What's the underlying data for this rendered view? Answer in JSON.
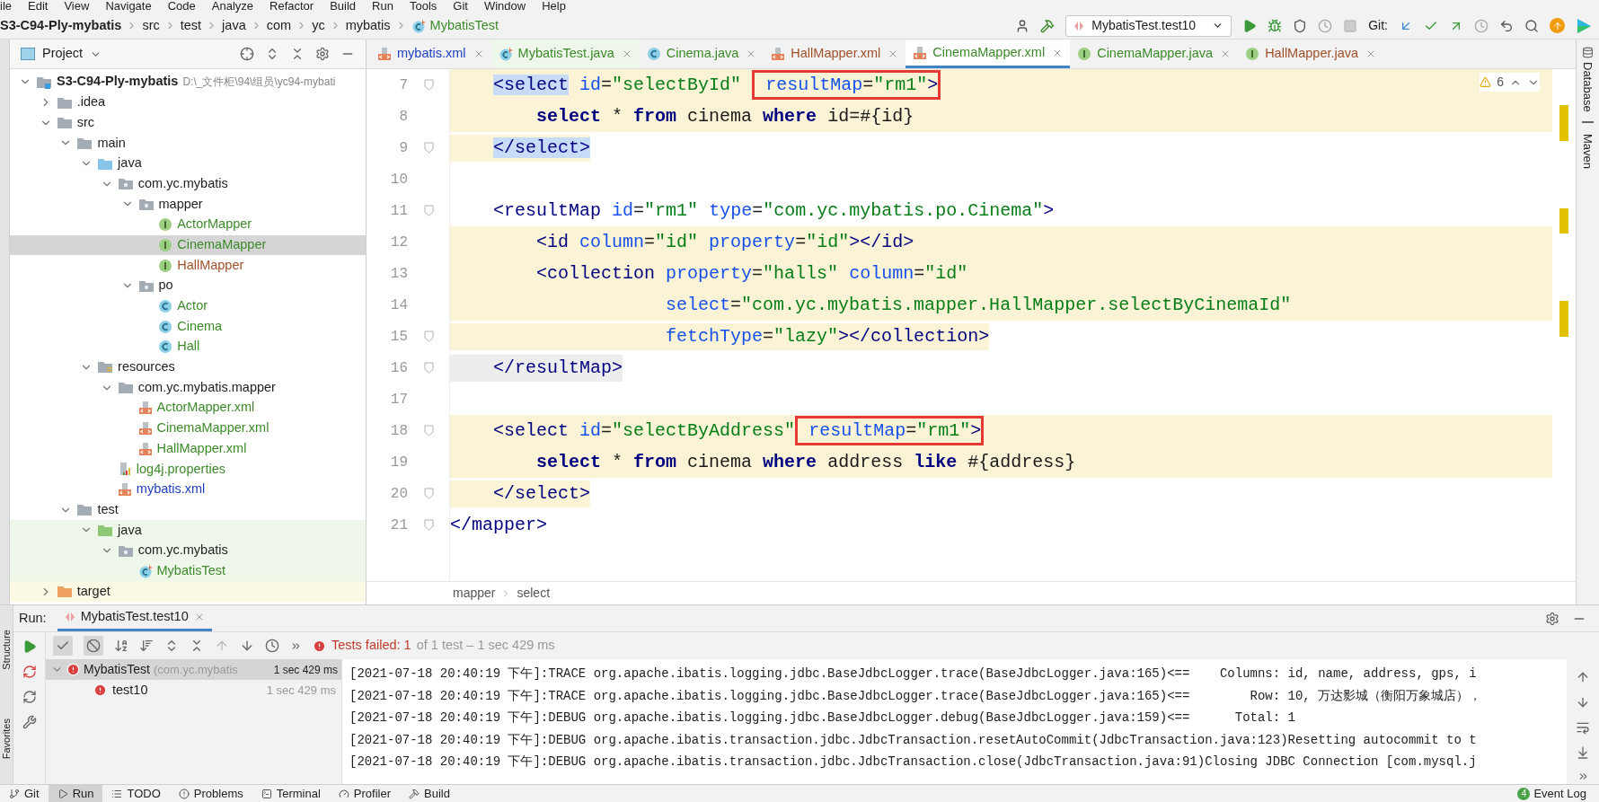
{
  "menu": [
    "ile",
    "Edit",
    "View",
    "Navigate",
    "Code",
    "Analyze",
    "Refactor",
    "Build",
    "Run",
    "Tools",
    "Git",
    "Window",
    "Help"
  ],
  "breadcrumb": [
    {
      "label": "S3-C94-Ply-mybatis",
      "kind": "project"
    },
    {
      "label": "src",
      "kind": "folder"
    },
    {
      "label": "test",
      "kind": "folder"
    },
    {
      "label": "java",
      "kind": "folder"
    },
    {
      "label": "com",
      "kind": "folder"
    },
    {
      "label": "yc",
      "kind": "folder"
    },
    {
      "label": "mybatis",
      "kind": "folder"
    },
    {
      "label": "MybatisTest",
      "kind": "test-class"
    }
  ],
  "toolbar": {
    "run_config": "MybatisTest.test10",
    "git_label": "Git:"
  },
  "project": {
    "title": "Project",
    "tree": [
      {
        "label": "S3-C94-Ply-mybatis",
        "path": "D:\\_文件柜\\94\\组员\\yc94-mybati",
        "kind": "module",
        "expanded": true,
        "selected": false,
        "children": [
          {
            "label": ".idea",
            "kind": "folder",
            "expanded": false,
            "selected": false
          },
          {
            "label": "src",
            "kind": "folder",
            "expanded": true,
            "selected": false,
            "children": [
              {
                "label": "main",
                "kind": "folder",
                "expanded": true,
                "selected": false,
                "children": [
                  {
                    "label": "java",
                    "kind": "source",
                    "expanded": true,
                    "selected": false,
                    "children": [
                      {
                        "label": "com.yc.mybatis",
                        "kind": "package",
                        "expanded": true,
                        "selected": false,
                        "children": [
                          {
                            "label": "mapper",
                            "kind": "package",
                            "expanded": true,
                            "selected": false,
                            "children": [
                              {
                                "label": "ActorMapper",
                                "kind": "interface",
                                "color": "#3d8a2a",
                                "selected": false
                              },
                              {
                                "label": "CinemaMapper",
                                "kind": "interface",
                                "color": "#3d8a2a",
                                "selected": true
                              },
                              {
                                "label": "HallMapper",
                                "kind": "interface",
                                "color": "#a0502a",
                                "selected": false
                              }
                            ]
                          },
                          {
                            "label": "po",
                            "kind": "package",
                            "expanded": true,
                            "selected": false,
                            "children": [
                              {
                                "label": "Actor",
                                "kind": "class",
                                "color": "#3d8a2a",
                                "selected": false
                              },
                              {
                                "label": "Cinema",
                                "kind": "class",
                                "color": "#3d8a2a",
                                "selected": false
                              },
                              {
                                "label": "Hall",
                                "kind": "class",
                                "color": "#3d8a2a",
                                "selected": false
                              }
                            ]
                          }
                        ]
                      }
                    ]
                  },
                  {
                    "label": "resources",
                    "kind": "resource",
                    "expanded": true,
                    "selected": false,
                    "children": [
                      {
                        "label": "com.yc.mybatis.mapper",
                        "kind": "folder",
                        "expanded": true,
                        "selected": false,
                        "children": [
                          {
                            "label": "ActorMapper.xml",
                            "kind": "xml",
                            "color": "#3d8a2a",
                            "selected": false
                          },
                          {
                            "label": "CinemaMapper.xml",
                            "kind": "xml",
                            "color": "#3d8a2a",
                            "selected": false
                          },
                          {
                            "label": "HallMapper.xml",
                            "kind": "xml",
                            "color": "#3d8a2a",
                            "selected": false
                          }
                        ]
                      },
                      {
                        "label": "log4j.properties",
                        "kind": "properties",
                        "color": "#3d8a2a",
                        "selected": false
                      },
                      {
                        "label": "mybatis.xml",
                        "kind": "xml",
                        "color": "#1f3fc0",
                        "selected": false
                      }
                    ]
                  }
                ]
              },
              {
                "label": "test",
                "kind": "folder",
                "expanded": true,
                "selected": false,
                "children": [
                  {
                    "label": "java",
                    "kind": "test-root",
                    "expanded": true,
                    "selected": false,
                    "children": [
                      {
                        "label": "com.yc.mybatis",
                        "kind": "test-package",
                        "expanded": true,
                        "selected": false,
                        "children": [
                          {
                            "label": "MybatisTest",
                            "kind": "test-class",
                            "color": "#3d8a2a",
                            "selected": false
                          }
                        ]
                      }
                    ]
                  }
                ]
              }
            ]
          },
          {
            "label": "target",
            "kind": "excluded",
            "expanded": false,
            "selected": false
          }
        ]
      }
    ]
  },
  "tabs": [
    {
      "label": "mybatis.xml",
      "kind": "xml",
      "color": "#1f3fc0",
      "selected": false
    },
    {
      "label": "MybatisTest.java",
      "kind": "test-class",
      "color": "#3d8a2a",
      "selected": false
    },
    {
      "label": "Cinema.java",
      "kind": "class",
      "color": "#3d8a2a",
      "selected": false
    },
    {
      "label": "HallMapper.xml",
      "kind": "xml",
      "color": "#a0502a",
      "selected": false
    },
    {
      "label": "CinemaMapper.xml",
      "kind": "xml",
      "color": "#3d8a2a",
      "selected": true
    },
    {
      "label": "CinemaMapper.java",
      "kind": "interface",
      "color": "#3d8a2a",
      "selected": false
    },
    {
      "label": "HallMapper.java",
      "kind": "interface",
      "color": "#a0502a",
      "selected": false
    }
  ],
  "editor": {
    "warnings": "6",
    "lines": [
      {
        "number": "7",
        "fold": true,
        "kind": "full",
        "tokens": [
          {
            "text": "    <select",
            "kind": "tag_match"
          },
          {
            "text": " id",
            "kind": "attr"
          },
          {
            "text": "=",
            "kind": "plain"
          },
          {
            "text": "\"selectById\" ",
            "kind": "value"
          }
        ],
        "boxed": [
          {
            "text": " resultMap",
            "kind": "attr"
          },
          {
            "text": "=",
            "kind": "plain"
          },
          {
            "text": "\"rm1\"",
            "kind": "value"
          },
          {
            "text": ">",
            "kind": "tag"
          }
        ]
      },
      {
        "number": "8",
        "fold": false,
        "kind": "full",
        "tokens": [
          {
            "text": "        select",
            "kind": "kw"
          },
          {
            "text": " * ",
            "kind": "plain"
          },
          {
            "text": "from",
            "kind": "kw"
          },
          {
            "text": " cinema ",
            "kind": "plain"
          },
          {
            "text": "where",
            "kind": "kw"
          },
          {
            "text": " id=#{id}",
            "kind": "plain"
          }
        ]
      },
      {
        "number": "9",
        "fold": true,
        "kind": "text",
        "tokens": [
          {
            "text": "    </select>",
            "kind": "tag_match"
          }
        ]
      },
      {
        "number": "10",
        "fold": false,
        "kind": "none"
      },
      {
        "number": "11",
        "fold": true,
        "kind": "none",
        "tokens": [
          {
            "text": "    <resultMap",
            "kind": "tag"
          },
          {
            "text": " id",
            "kind": "attr"
          },
          {
            "text": "=",
            "kind": "plain"
          },
          {
            "text": "\"rm1\"",
            "kind": "value"
          },
          {
            "text": " type",
            "kind": "attr"
          },
          {
            "text": "=",
            "kind": "plain"
          },
          {
            "text": "\"com.yc.mybatis.po.Cinema\"",
            "kind": "value"
          },
          {
            "text": ">",
            "kind": "tag"
          }
        ]
      },
      {
        "number": "12",
        "fold": false,
        "kind": "full",
        "tokens": [
          {
            "text": "        <id",
            "kind": "tag"
          },
          {
            "text": " column",
            "kind": "attr"
          },
          {
            "text": "=",
            "kind": "plain"
          },
          {
            "text": "\"id\"",
            "kind": "value"
          },
          {
            "text": " property",
            "kind": "attr"
          },
          {
            "text": "=",
            "kind": "plain"
          },
          {
            "text": "\"id\"",
            "kind": "value"
          },
          {
            "text": "></id>",
            "kind": "tag"
          }
        ]
      },
      {
        "number": "13",
        "fold": false,
        "kind": "full",
        "tokens": [
          {
            "text": "        <collection",
            "kind": "tag"
          },
          {
            "text": " property",
            "kind": "attr"
          },
          {
            "text": "=",
            "kind": "plain"
          },
          {
            "text": "\"halls\"",
            "kind": "value"
          },
          {
            "text": " column",
            "kind": "attr"
          },
          {
            "text": "=",
            "kind": "plain"
          },
          {
            "text": "\"id\"",
            "kind": "value"
          }
        ]
      },
      {
        "number": "14",
        "fold": false,
        "kind": "full",
        "tokens": [
          {
            "text": "                    select",
            "kind": "attr"
          },
          {
            "text": "=",
            "kind": "plain"
          },
          {
            "text": "\"com.yc.mybatis.mapper.HallMapper.selectByCinemaId\"",
            "kind": "value"
          }
        ]
      },
      {
        "number": "15",
        "fold": true,
        "kind": "text",
        "tokens": [
          {
            "text": "                    fetchType",
            "kind": "attr"
          },
          {
            "text": "=",
            "kind": "plain"
          },
          {
            "text": "\"lazy\"",
            "kind": "value"
          },
          {
            "text": "></collection>",
            "kind": "tag"
          }
        ]
      },
      {
        "number": "16",
        "fold": true,
        "kind": "dim",
        "tokens": [
          {
            "text": "    </resultMap>",
            "kind": "tag"
          }
        ]
      },
      {
        "number": "17",
        "fold": false,
        "kind": "none"
      },
      {
        "number": "18",
        "fold": true,
        "kind": "full",
        "tokens": [
          {
            "text": "    <select",
            "kind": "tag"
          },
          {
            "text": " id",
            "kind": "attr"
          },
          {
            "text": "=",
            "kind": "plain"
          },
          {
            "text": "\"selectByAddress\"",
            "kind": "value"
          }
        ],
        "boxed": [
          {
            "text": " resultMap",
            "kind": "attr"
          },
          {
            "text": "=",
            "kind": "plain"
          },
          {
            "text": "\"rm1\"",
            "kind": "value"
          },
          {
            "text": ">",
            "kind": "tag"
          }
        ]
      },
      {
        "number": "19",
        "fold": false,
        "kind": "full",
        "tokens": [
          {
            "text": "        select",
            "kind": "kw"
          },
          {
            "text": " * ",
            "kind": "plain"
          },
          {
            "text": "from",
            "kind": "kw"
          },
          {
            "text": " cinema ",
            "kind": "plain"
          },
          {
            "text": "where",
            "kind": "kw"
          },
          {
            "text": " address ",
            "kind": "plain"
          },
          {
            "text": "like",
            "kind": "kw"
          },
          {
            "text": " #{address}",
            "kind": "plain"
          }
        ]
      },
      {
        "number": "20",
        "fold": true,
        "kind": "text",
        "tokens": [
          {
            "text": "    </select>",
            "kind": "tag"
          }
        ]
      },
      {
        "number": "21",
        "fold": true,
        "kind": "none",
        "tokens": [
          {
            "text": "</mapper>",
            "kind": "tag"
          }
        ]
      }
    ],
    "breadcrumb": [
      "mapper",
      "select"
    ]
  },
  "right_strip": [
    "Database",
    "Maven"
  ],
  "run": {
    "label": "Run:",
    "tab": "MybatisTest.test10",
    "status": "Tests failed: 1",
    "summary": "of 1 test – 1 sec 429 ms",
    "tests": [
      {
        "name": "MybatisTest",
        "package": "(com.yc.mybatis",
        "time": "1 sec 429 ms",
        "kind": "failed",
        "selected": true,
        "children": [
          {
            "name": "test10",
            "time": "1 sec 429 ms",
            "kind": "failed",
            "selected": false
          }
        ]
      }
    ],
    "log": [
      "[2021-07-18 20:40:19 下午]:TRACE org.apache.ibatis.logging.jdbc.BaseJdbcLogger.trace(BaseJdbcLogger.java:165)<==    Columns: id, name, address, gps, i",
      "[2021-07-18 20:40:19 下午]:TRACE org.apache.ibatis.logging.jdbc.BaseJdbcLogger.trace(BaseJdbcLogger.java:165)<==        Row: 10, 万达影城（衡阳万象城店），",
      "[2021-07-18 20:40:19 下午]:DEBUG org.apache.ibatis.logging.jdbc.BaseJdbcLogger.debug(BaseJdbcLogger.java:159)<==      Total: 1",
      "[2021-07-18 20:40:19 下午]:DEBUG org.apache.ibatis.transaction.jdbc.JdbcTransaction.resetAutoCommit(JdbcTransaction.java:123)Resetting autocommit to t",
      "[2021-07-18 20:40:19 下午]:DEBUG org.apache.ibatis.transaction.jdbc.JdbcTransaction.close(JdbcTransaction.java:91)Closing JDBC Connection [com.mysql.j"
    ]
  },
  "left_strip": [
    "Structure",
    "Favorites"
  ],
  "bottom_tabs": [
    {
      "label": "Git",
      "kind": "git",
      "selected": false
    },
    {
      "label": "Run",
      "kind": "run",
      "selected": true
    },
    {
      "label": "TODO",
      "kind": "todo",
      "selected": false
    },
    {
      "label": "Problems",
      "kind": "problems",
      "selected": false
    },
    {
      "label": "Terminal",
      "kind": "terminal",
      "selected": false
    },
    {
      "label": "Profiler",
      "kind": "profiler",
      "selected": false
    },
    {
      "label": "Build",
      "kind": "build",
      "selected": false
    }
  ],
  "event_log": {
    "count": "4",
    "label": "Event Log"
  }
}
